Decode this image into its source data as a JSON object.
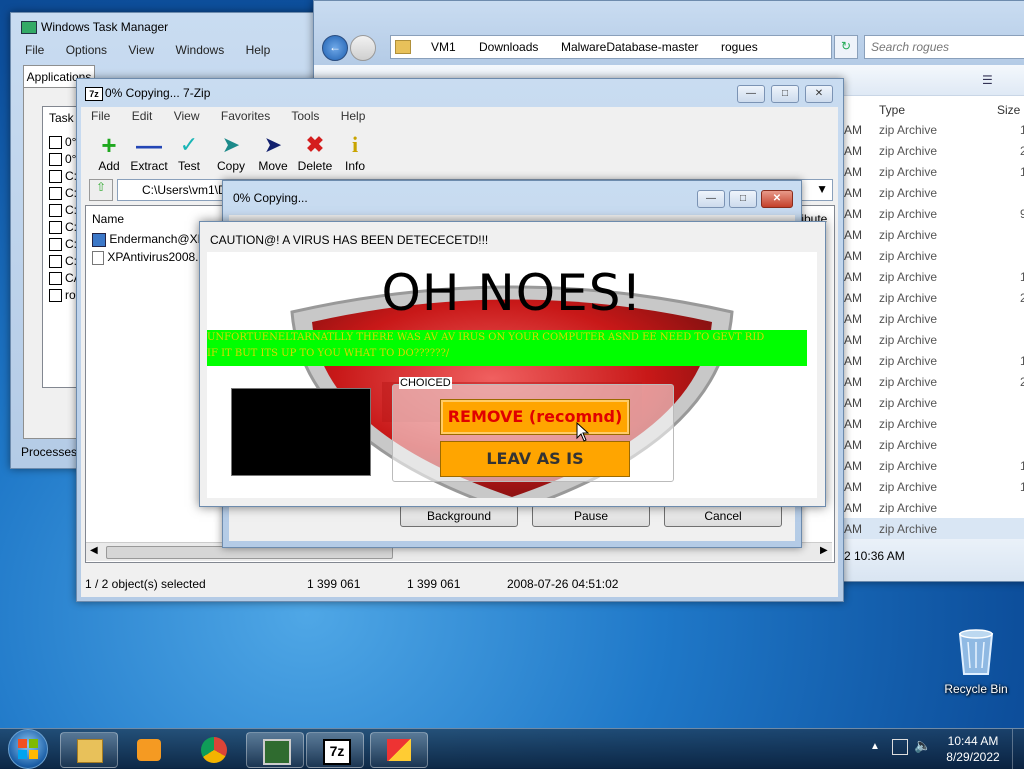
{
  "task_manager": {
    "title": "Windows Task Manager",
    "menu": [
      "File",
      "Options",
      "View",
      "Windows",
      "Help"
    ],
    "tab_active": "Applications",
    "column": "Task",
    "rows": [
      "0°",
      "0°",
      "C:",
      "C:",
      "C:",
      "C:",
      "C:",
      "C:",
      "CA",
      "ro"
    ],
    "processes_label": "Processes:"
  },
  "explorer": {
    "breadcrumb": [
      "VM1",
      "Downloads",
      "MalwareDatabase-master",
      "rogues"
    ],
    "search_placeholder": "Search rogues",
    "col_type": "Type",
    "col_size": "Size",
    "rows": [
      {
        "time": "AM",
        "type": "zip Archive",
        "size": "1"
      },
      {
        "time": "AM",
        "type": "zip Archive",
        "size": "2"
      },
      {
        "time": "AM",
        "type": "zip Archive",
        "size": "1"
      },
      {
        "time": "AM",
        "type": "zip Archive",
        "size": ""
      },
      {
        "time": "AM",
        "type": "zip Archive",
        "size": "9"
      },
      {
        "time": "AM",
        "type": "zip Archive",
        "size": ""
      },
      {
        "time": "AM",
        "type": "zip Archive",
        "size": ""
      },
      {
        "time": "AM",
        "type": "zip Archive",
        "size": "1"
      },
      {
        "time": "AM",
        "type": "zip Archive",
        "size": "2"
      },
      {
        "time": "AM",
        "type": "zip Archive",
        "size": ""
      },
      {
        "time": "AM",
        "type": "zip Archive",
        "size": ""
      },
      {
        "time": "AM",
        "type": "zip Archive",
        "size": "1"
      },
      {
        "time": "AM",
        "type": "zip Archive",
        "size": "2"
      },
      {
        "time": "AM",
        "type": "zip Archive",
        "size": ""
      },
      {
        "time": "AM",
        "type": "zip Archive",
        "size": ""
      },
      {
        "time": "AM",
        "type": "zip Archive",
        "size": ""
      },
      {
        "time": "AM",
        "type": "zip Archive",
        "size": "1"
      },
      {
        "time": "AM",
        "type": "zip Archive",
        "size": "1"
      },
      {
        "time": "AM",
        "type": "zip Archive",
        "size": ""
      },
      {
        "time": "AM",
        "type": "zip Archive",
        "size": ""
      }
    ],
    "status_time": "2 10:36 AM"
  },
  "sevenzip": {
    "title": "0% Copying... 7-Zip",
    "menu": [
      "File",
      "Edit",
      "View",
      "Favorites",
      "Tools",
      "Help"
    ],
    "toolbar": [
      "Add",
      "Extract",
      "Test",
      "Copy",
      "Move",
      "Delete",
      "Info"
    ],
    "path": "C:\\Users\\vm1\\D",
    "col_name": "Name",
    "col_attr": "tribute",
    "files": [
      "Endermanch@XP",
      "XPAntivirus2008.i"
    ],
    "status": [
      "1 / 2 object(s) selected",
      "1 399 061",
      "1 399 061",
      "2008-07-26 04:51:02"
    ]
  },
  "copy_dialog": {
    "title": "0% Copying...",
    "buttons": [
      "Background",
      "Pause",
      "Cancel"
    ]
  },
  "virus_dialog": {
    "title": "CAUTION@! A VIRUS HAS BEEN DETECECETD!!!",
    "headline": "OH NOES!",
    "banner_line1": "UNFORTUENELTARNATLLY THERE WAS AV AV IRUS ON YOUR COMPUTER ASND EE NEED TO GEVT RID",
    "banner_line2": "IF IT BUT ITS UP TO YOU WHAT TO DO??????/",
    "group_label": "CHOICED",
    "remove_label": "REMOVE (recomnd)",
    "leave_label": "LEAV AS IS"
  },
  "desktop": {
    "recycle_bin": "Recycle Bin"
  },
  "taskbar": {
    "time": "10:44 AM",
    "date": "8/29/2022",
    "apps": [
      "explorer-icon",
      "media-player-icon",
      "chrome-icon",
      "task-manager-icon",
      "7zip-icon",
      "rogue-app-icon"
    ]
  },
  "colors": {
    "banner_green": "#00ff00",
    "banner_text": "#d8d800",
    "button_orange": "#ffa500",
    "remove_text": "#e00000",
    "desktop_blue": "#1f78c8"
  }
}
